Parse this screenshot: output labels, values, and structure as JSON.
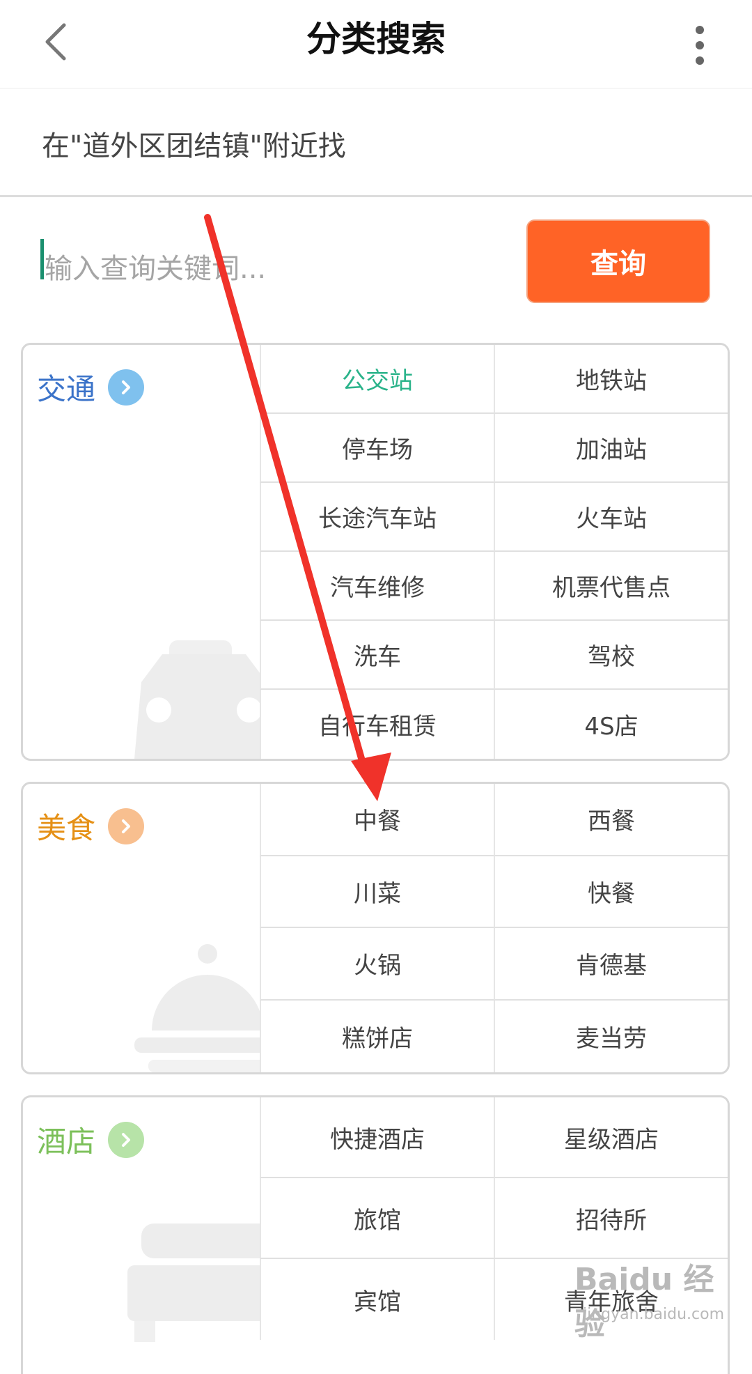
{
  "header": {
    "title": "分类搜索",
    "back_icon": "chevron-left-icon",
    "more_icon": "more-vertical-icon"
  },
  "location": {
    "text": "在\"道外区团结镇\"附近找"
  },
  "search": {
    "placeholder": "输入查询关键词...",
    "value": "",
    "button_label": "查询",
    "button_color": "#ff6326"
  },
  "categories": [
    {
      "label": "交通",
      "color": "#3b73c9",
      "chevron_color": "#7fc1ee",
      "watermark_icon": "car-icon",
      "items": [
        "公交站",
        "地铁站",
        "停车场",
        "加油站",
        "长途汽车站",
        "火车站",
        "汽车维修",
        "机票代售点",
        "洗车",
        "驾校",
        "自行车租赁",
        "4S店"
      ],
      "active_index": 0
    },
    {
      "label": "美食",
      "color": "#e59015",
      "chevron_color": "#f8bf8f",
      "watermark_icon": "food-cloche-icon",
      "items": [
        "中餐",
        "西餐",
        "川菜",
        "快餐",
        "火锅",
        "肯德基",
        "糕饼店",
        "麦当劳"
      ]
    },
    {
      "label": "酒店",
      "color": "#7cc05a",
      "chevron_color": "#b7e3a8",
      "watermark_icon": "bed-icon",
      "items": [
        "快捷酒店",
        "星级酒店",
        "旅馆",
        "招待所",
        "宾馆",
        "青年旅舍"
      ]
    }
  ],
  "watermark": {
    "brand": "Baidu 经验",
    "url": "jingyan.baidu.com"
  },
  "annotation": {
    "color": "#f0322a"
  }
}
